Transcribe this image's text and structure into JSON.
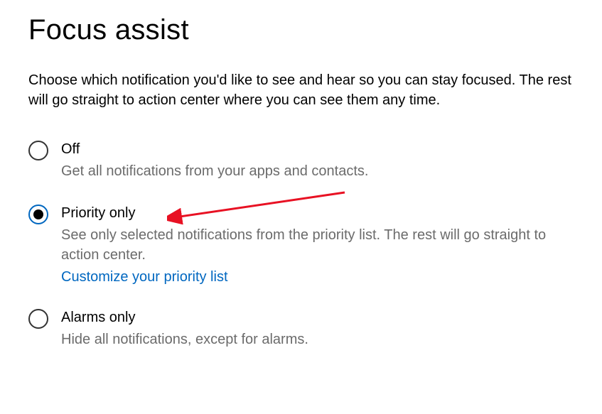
{
  "title": "Focus assist",
  "intro": "Choose which notification you'd like to see and hear so you can stay focused. The rest will go straight to action center where you can see them any time.",
  "options": {
    "off": {
      "label": "Off",
      "desc": "Get all notifications from your apps and contacts.",
      "selected": false
    },
    "priority": {
      "label": "Priority only",
      "desc": "See only selected notifications from the priority list. The rest will go straight to action center.",
      "link": "Customize your priority list",
      "selected": true
    },
    "alarms": {
      "label": "Alarms only",
      "desc": "Hide all notifications, except for alarms.",
      "selected": false
    }
  }
}
